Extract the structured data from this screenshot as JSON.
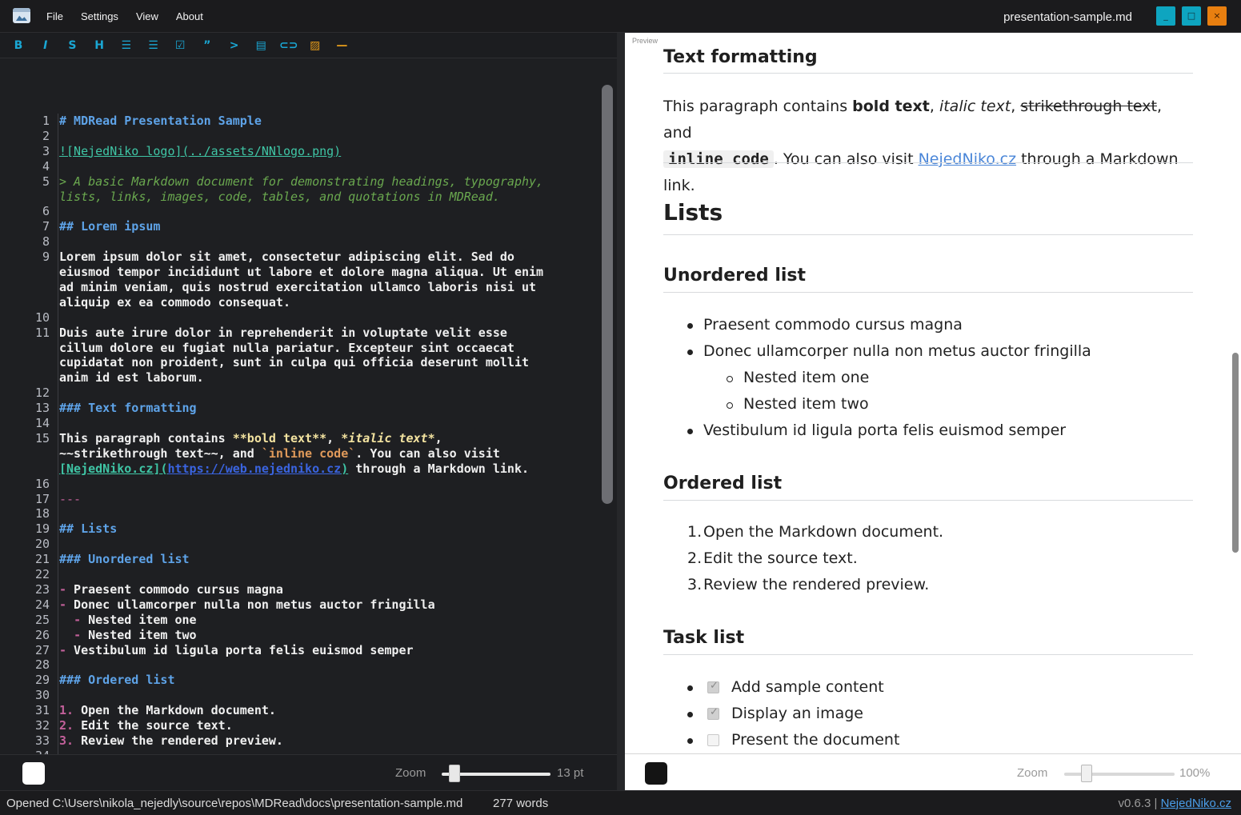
{
  "window": {
    "title": "presentation-sample.md",
    "menu": [
      "File",
      "Settings",
      "View",
      "About"
    ],
    "buttons": {
      "minimize": "_",
      "maximize": "□",
      "close": "×"
    }
  },
  "toolbar": {
    "icons": [
      "bold-icon",
      "italic-icon",
      "strikethrough-icon",
      "heading-icon",
      "unordered-list-icon",
      "ordered-list-icon",
      "task-list-icon",
      "quote-icon",
      "code-icon",
      "table-icon",
      "link-icon",
      "image-icon",
      "horizontal-rule-icon"
    ],
    "glyphs": [
      "B",
      "I",
      "S",
      "H",
      "☰",
      "☰",
      "☑",
      "”",
      "&gt;",
      "▤",
      "⊂⊃",
      "▨",
      "—"
    ]
  },
  "editor": {
    "lines": [
      {
        "n": "1",
        "text": "# MDRead Presentation Sample",
        "kind": "h"
      },
      {
        "n": "2",
        "text": "",
        "kind": "plain"
      },
      {
        "n": "3",
        "text": "![NejedNiko logo](../assets/NNlogo.png)",
        "kind": "lnk"
      },
      {
        "n": "4",
        "text": "",
        "kind": "plain"
      },
      {
        "n": "5",
        "text": "> A basic Markdown document for demonstrating headings, typography,",
        "kind": "quote"
      },
      {
        "n": "",
        "text": "lists, links, images, code, tables, and quotations in MDRead.",
        "kind": "quote"
      },
      {
        "n": "6",
        "text": "",
        "kind": "plain"
      },
      {
        "n": "7",
        "text": "## Lorem ipsum",
        "kind": "h"
      },
      {
        "n": "8",
        "text": "",
        "kind": "plain"
      },
      {
        "n": "9",
        "text": "Lorem ipsum dolor sit amet, consectetur adipiscing elit. Sed do",
        "kind": "plain"
      },
      {
        "n": "",
        "text": "eiusmod tempor incididunt ut labore et dolore magna aliqua. Ut enim",
        "kind": "plain"
      },
      {
        "n": "",
        "text": "ad minim veniam, quis nostrud exercitation ullamco laboris nisi ut",
        "kind": "plain"
      },
      {
        "n": "",
        "text": "aliquip ex ea commodo consequat.",
        "kind": "plain"
      },
      {
        "n": "10",
        "text": "",
        "kind": "plain"
      },
      {
        "n": "11",
        "text": "Duis aute irure dolor in reprehenderit in voluptate velit esse",
        "kind": "plain"
      },
      {
        "n": "",
        "text": "cillum dolore eu fugiat nulla pariatur. Excepteur sint occaecat",
        "kind": "plain"
      },
      {
        "n": "",
        "text": "cupidatat non proident, sunt in culpa qui officia deserunt mollit",
        "kind": "plain"
      },
      {
        "n": "",
        "text": "anim id est laborum.",
        "kind": "plain"
      },
      {
        "n": "12",
        "text": "",
        "kind": "plain"
      },
      {
        "n": "13",
        "text": "### Text formatting",
        "kind": "h"
      },
      {
        "n": "14",
        "text": "",
        "kind": "plain"
      },
      {
        "n": "15",
        "text": "This paragraph contains **bold text**, *italic text*,",
        "kind": "fmt1"
      },
      {
        "n": "",
        "text": "~~strikethrough text~~, and `inline code`. You can also visit",
        "kind": "fmt2"
      },
      {
        "n": "",
        "text": "[NejedNiko.cz](https://web.nejedniko.cz) through a Markdown link.",
        "kind": "fmt3"
      },
      {
        "n": "16",
        "text": "",
        "kind": "plain"
      },
      {
        "n": "17",
        "text": "---",
        "kind": "hr"
      },
      {
        "n": "18",
        "text": "",
        "kind": "plain"
      },
      {
        "n": "19",
        "text": "## Lists",
        "kind": "h"
      },
      {
        "n": "20",
        "text": "",
        "kind": "plain"
      },
      {
        "n": "21",
        "text": "### Unordered list",
        "kind": "h"
      },
      {
        "n": "22",
        "text": "",
        "kind": "plain"
      },
      {
        "n": "23",
        "text": "- Praesent commodo cursus magna",
        "kind": "li"
      },
      {
        "n": "24",
        "text": "- Donec ullamcorper nulla non metus auctor fringilla",
        "kind": "li"
      },
      {
        "n": "25",
        "text": "  - Nested item one",
        "kind": "li"
      },
      {
        "n": "26",
        "text": "  - Nested item two",
        "kind": "li"
      },
      {
        "n": "27",
        "text": "- Vestibulum id ligula porta felis euismod semper",
        "kind": "li"
      },
      {
        "n": "28",
        "text": "",
        "kind": "plain"
      },
      {
        "n": "29",
        "text": "### Ordered list",
        "kind": "h"
      },
      {
        "n": "30",
        "text": "",
        "kind": "plain"
      },
      {
        "n": "31",
        "text": "1. Open the Markdown document.",
        "kind": "ol"
      },
      {
        "n": "32",
        "text": "2. Edit the source text.",
        "kind": "ol"
      },
      {
        "n": "33",
        "text": "3. Review the rendered preview.",
        "kind": "ol"
      },
      {
        "n": "34",
        "text": "",
        "kind": "plain"
      }
    ],
    "zoom_label": "Zoom",
    "zoom_value": "13 pt",
    "zoom_fraction": 0.12,
    "color_chip": "#ffffff"
  },
  "preview": {
    "label": "Preview",
    "h_text_formatting": "Text formatting",
    "p1_a": "This paragraph contains ",
    "p1_bold": "bold text",
    "p1_b": ", ",
    "p1_italic": "italic text",
    "p1_c": ", ",
    "p1_strike": "strikethrough text",
    "p1_d": ", and",
    "p1_code": "inline code",
    "p1_e": ". You can also visit ",
    "p1_link": "NejedNiko.cz",
    "p1_f": " through a Markdown link.",
    "h_lists": "Lists",
    "h_unordered": "Unordered list",
    "ul": [
      "Praesent commodo cursus magna",
      "Donec ullamcorper nulla non metus auctor fringilla",
      "Nested item one",
      "Nested item two",
      "Vestibulum id ligula porta felis euismod semper"
    ],
    "h_ordered": "Ordered list",
    "ol_nums": [
      "1.",
      "2.",
      "3."
    ],
    "ol": [
      "Open the Markdown document.",
      "Edit the source text.",
      "Review the rendered preview."
    ],
    "h_task": "Task list",
    "tasks": [
      {
        "label": "Add sample content",
        "checked": true
      },
      {
        "label": "Display an image",
        "checked": true
      },
      {
        "label": "Present the document",
        "checked": false
      }
    ],
    "zoom_label": "Zoom",
    "zoom_value": "100%",
    "zoom_fraction": 0.2,
    "color_chip": "#141414"
  },
  "status": {
    "opened": "Opened C:\\Users\\nikola_nejedly\\source\\repos\\MDRead\\docs\\presentation-sample.md",
    "words": "277 words",
    "version": "v0.6.3 | ",
    "site": "NejedNiko.cz"
  },
  "colors": {
    "accent": "#0ea5c0",
    "close": "#e87f10",
    "heading": "#5ea3e8",
    "link": "#3fc5a5"
  }
}
